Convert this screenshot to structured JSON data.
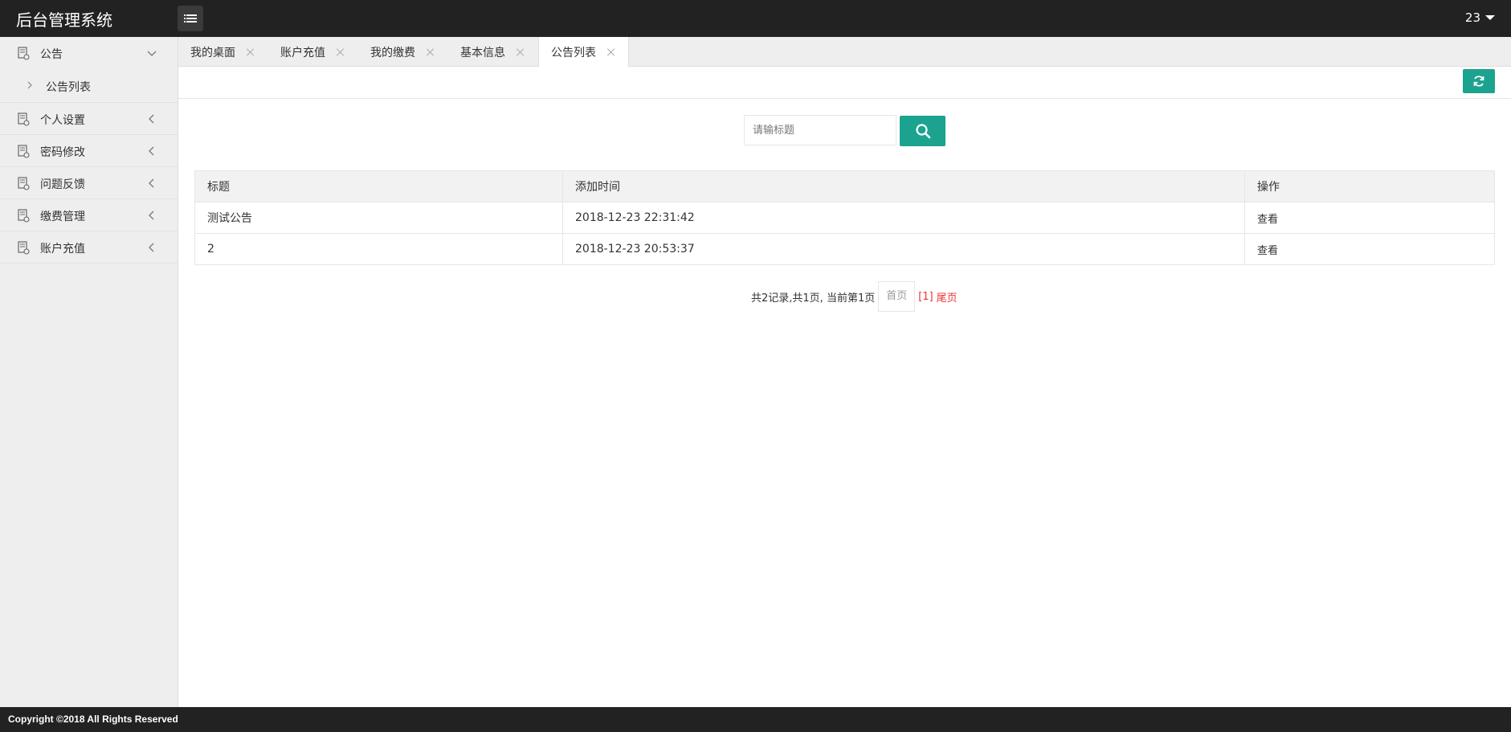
{
  "header": {
    "title": "后台管理系统",
    "user": "23"
  },
  "sidebar": {
    "items": [
      {
        "label": "公告",
        "expanded": true,
        "children": [
          {
            "label": "公告列表"
          }
        ]
      },
      {
        "label": "个人设置"
      },
      {
        "label": "密码修改"
      },
      {
        "label": "问题反馈"
      },
      {
        "label": "缴费管理"
      },
      {
        "label": "账户充值"
      }
    ]
  },
  "tabs": [
    {
      "label": "我的桌面"
    },
    {
      "label": "账户充值"
    },
    {
      "label": "我的缴费"
    },
    {
      "label": "基本信息"
    },
    {
      "label": "公告列表",
      "active": true
    }
  ],
  "search": {
    "placeholder": "请输标题",
    "value": ""
  },
  "table": {
    "headers": [
      "标题",
      "添加时间",
      "操作"
    ],
    "rows": [
      {
        "title": "测试公告",
        "time": "2018-12-23 22:31:42",
        "action": "查看"
      },
      {
        "title": "2",
        "time": "2018-12-23 20:53:37",
        "action": "查看"
      }
    ]
  },
  "pager": {
    "summary": "共2记录,共1页, 当前第1页",
    "first": "首页",
    "current": "[1]",
    "last": "尾页"
  },
  "footer": {
    "copyright": "Copyright ©2018 All Rights Reserved"
  },
  "colors": {
    "header_bg": "#222222",
    "sidebar_bg": "#eeeeee",
    "accent": "#1ba38f",
    "pager_active": "#ee3333"
  }
}
